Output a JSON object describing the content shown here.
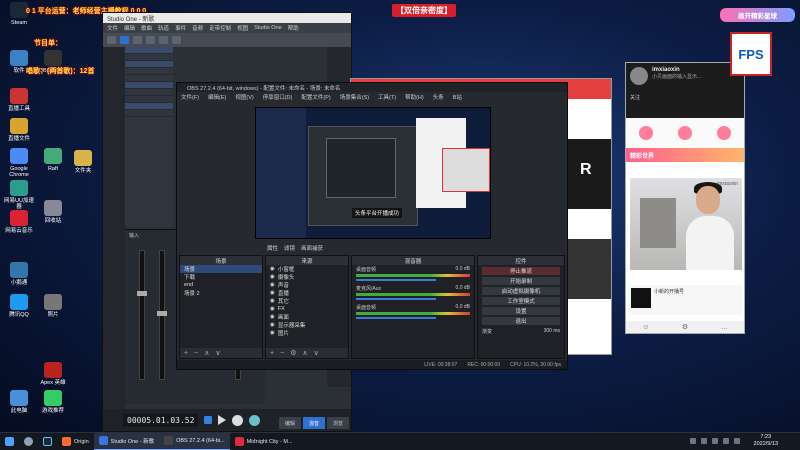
{
  "desktop": {
    "icons": [
      {
        "label": "Steam",
        "color": "#1b2838"
      },
      {
        "label": "软件",
        "color": "#3b82c4"
      },
      {
        "label": "直播工具",
        "color": "#c33"
      },
      {
        "label": "直播文件",
        "color": "#d7a430"
      },
      {
        "label": "Google Chrome",
        "color": "#4c8bf5"
      },
      {
        "label": "网易UU加速器",
        "color": "#2a9d8f"
      },
      {
        "label": "网易云音乐",
        "color": "#d23"
      },
      {
        "label": "小鹅通",
        "color": "#37a"
      },
      {
        "label": "腾讯QQ",
        "color": "#1e9bf0"
      },
      {
        "label": "照片",
        "color": "#777"
      },
      {
        "label": "回收站",
        "color": "#889"
      },
      {
        "label": "OBS Studio",
        "color": "#333"
      },
      {
        "label": "Raft",
        "color": "#4a7"
      },
      {
        "label": "文件夹",
        "color": "#d9b24a"
      },
      {
        "label": "Apex 英雄",
        "color": "#b22"
      },
      {
        "label": "此电脑",
        "color": "#4a90d9"
      },
      {
        "label": "游戏推荐",
        "color": "#3c6"
      }
    ]
  },
  "captions": {
    "line1": "0 1 平台运营：老师经营主播教程 0 0 0",
    "line2": "节目单：",
    "line3": "唱歌：(两首歌)：12首",
    "top_center": "【双倍亲密度】"
  },
  "studio_one": {
    "title": "Studio One - 新歌",
    "menu": [
      "文件",
      "编辑",
      "歌曲",
      "轨道",
      "事件",
      "音频",
      "走带控制",
      "视图",
      "Studio One",
      "帮助"
    ],
    "time": "00005.01.03.52",
    "edit_buttons": [
      "编辑",
      "混音",
      "浏览"
    ],
    "channel_label": "输入"
  },
  "obs": {
    "title": "OBS 27.2.4 (64-bit, windows) - 配置文件: 未命名 - 场景: 未命名",
    "menu": [
      "文件(F)",
      "编辑(E)",
      "视图(V)",
      "停靠窗口(D)",
      "配置文件(P)",
      "场景集合(S)",
      "工具(T)",
      "帮助(H)",
      "头条",
      "B站"
    ],
    "preview_text": "头条平台开播成功",
    "controls": [
      "属性",
      "滤镜",
      "画面捕获"
    ],
    "scenes_title": "场景",
    "scenes": [
      "场景",
      "下载",
      "end",
      "场景 2"
    ],
    "sources_title": "来源",
    "sources": [
      "小窗框",
      "摄像头",
      "声音",
      "直播",
      "其它",
      "FX",
      "画面",
      "显示器采集",
      "图片"
    ],
    "mixer_title": "混音器",
    "mixer": [
      {
        "name": "桌面音频",
        "db": "0.0 dB"
      },
      {
        "name": "麦克风/Aux",
        "db": "0.0 dB"
      },
      {
        "name": "桌面音频",
        "db": "0.0 dB"
      }
    ],
    "transitions_label": "渐变",
    "duration": "300 ms",
    "controls_title": "控件",
    "control_buttons": [
      "停止推流",
      "开始录制",
      "启动虚拟摄像机",
      "工作室模式",
      "设置",
      "退出"
    ],
    "status": [
      "LIVE: 00:38:07",
      "REC: 00:00:00",
      "CPU: 10.2%, 30.00 fps"
    ]
  },
  "browser": {
    "title": "mdl",
    "hero_letter": "R"
  },
  "chat": {
    "username": "imxiaoxin",
    "subtitle": "小贝画面的输入显示...",
    "follow": "关注",
    "banner": "精彩世界",
    "preview_label": "小新的开播号",
    "watermark": "imxiaoxin"
  },
  "badge": {
    "title": "画开精彩星球",
    "logo": "FPS"
  },
  "taskbar": {
    "items": [
      {
        "label": "Origin",
        "color": "#f56c2d"
      },
      {
        "label": "Studio One - 新歌",
        "color": "#3a74e0"
      },
      {
        "label": "OBS 27.2.4 (64-bi...",
        "color": "#444"
      },
      {
        "label": "Midnight City - M...",
        "color": "#e12b3a"
      }
    ],
    "time": "7:23",
    "date": "2022/9/13"
  }
}
